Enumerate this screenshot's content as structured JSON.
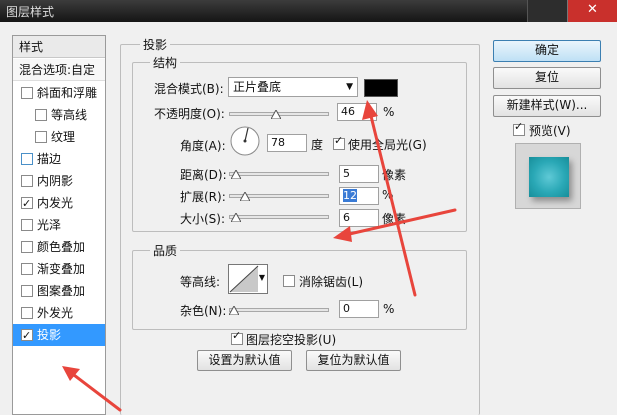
{
  "window": {
    "title": "图层样式"
  },
  "left_panel": {
    "header": "样式",
    "blend_options": "混合选项:自定",
    "items": [
      {
        "label": "斜面和浮雕",
        "checked": false,
        "indent": false
      },
      {
        "label": "等高线",
        "checked": false,
        "indent": true
      },
      {
        "label": "纹理",
        "checked": false,
        "indent": true
      },
      {
        "label": "描边",
        "checked": false,
        "indent": false
      },
      {
        "label": "内阴影",
        "checked": false,
        "indent": false
      },
      {
        "label": "内发光",
        "checked": true,
        "indent": false
      },
      {
        "label": "光泽",
        "checked": false,
        "indent": false
      },
      {
        "label": "颜色叠加",
        "checked": false,
        "indent": false
      },
      {
        "label": "渐变叠加",
        "checked": false,
        "indent": false
      },
      {
        "label": "图案叠加",
        "checked": false,
        "indent": false
      },
      {
        "label": "外发光",
        "checked": false,
        "indent": false
      },
      {
        "label": "投影",
        "checked": true,
        "indent": false,
        "selected": true
      }
    ]
  },
  "section_title": "投影",
  "structure": {
    "title": "结构",
    "blend_mode_label": "混合模式(B):",
    "blend_mode_value": "正片叠底",
    "blend_color": "#000000",
    "opacity_label": "不透明度(O):",
    "opacity_value": "46",
    "opacity_unit": "%",
    "angle_label": "角度(A):",
    "angle_value": "78",
    "angle_unit": "度",
    "global_light_label": "使用全局光(G)",
    "global_light_checked": true,
    "distance_label": "距离(D):",
    "distance_value": "5",
    "distance_unit": "像素",
    "spread_label": "扩展(R):",
    "spread_value": "12",
    "spread_unit": "%",
    "size_label": "大小(S):",
    "size_value": "6",
    "size_unit": "像素"
  },
  "quality": {
    "title": "品质",
    "contour_label": "等高线:",
    "antialias_label": "消除锯齿(L)",
    "antialias_checked": false,
    "noise_label": "杂色(N):",
    "noise_value": "0",
    "noise_unit": "%"
  },
  "knockout_label": "图层挖空投影(U)",
  "knockout_checked": true,
  "buttons": {
    "make_default": "设置为默认值",
    "reset_default": "复位为默认值",
    "ok": "确定",
    "reset": "复位",
    "new_style": "新建样式(W)...",
    "preview_label": "预览(V)",
    "preview_checked": true
  },
  "colors": {
    "selection": "#3399ff",
    "annotation_arrow": "#e8453c",
    "preview_swatch": "#2aa8b6"
  }
}
